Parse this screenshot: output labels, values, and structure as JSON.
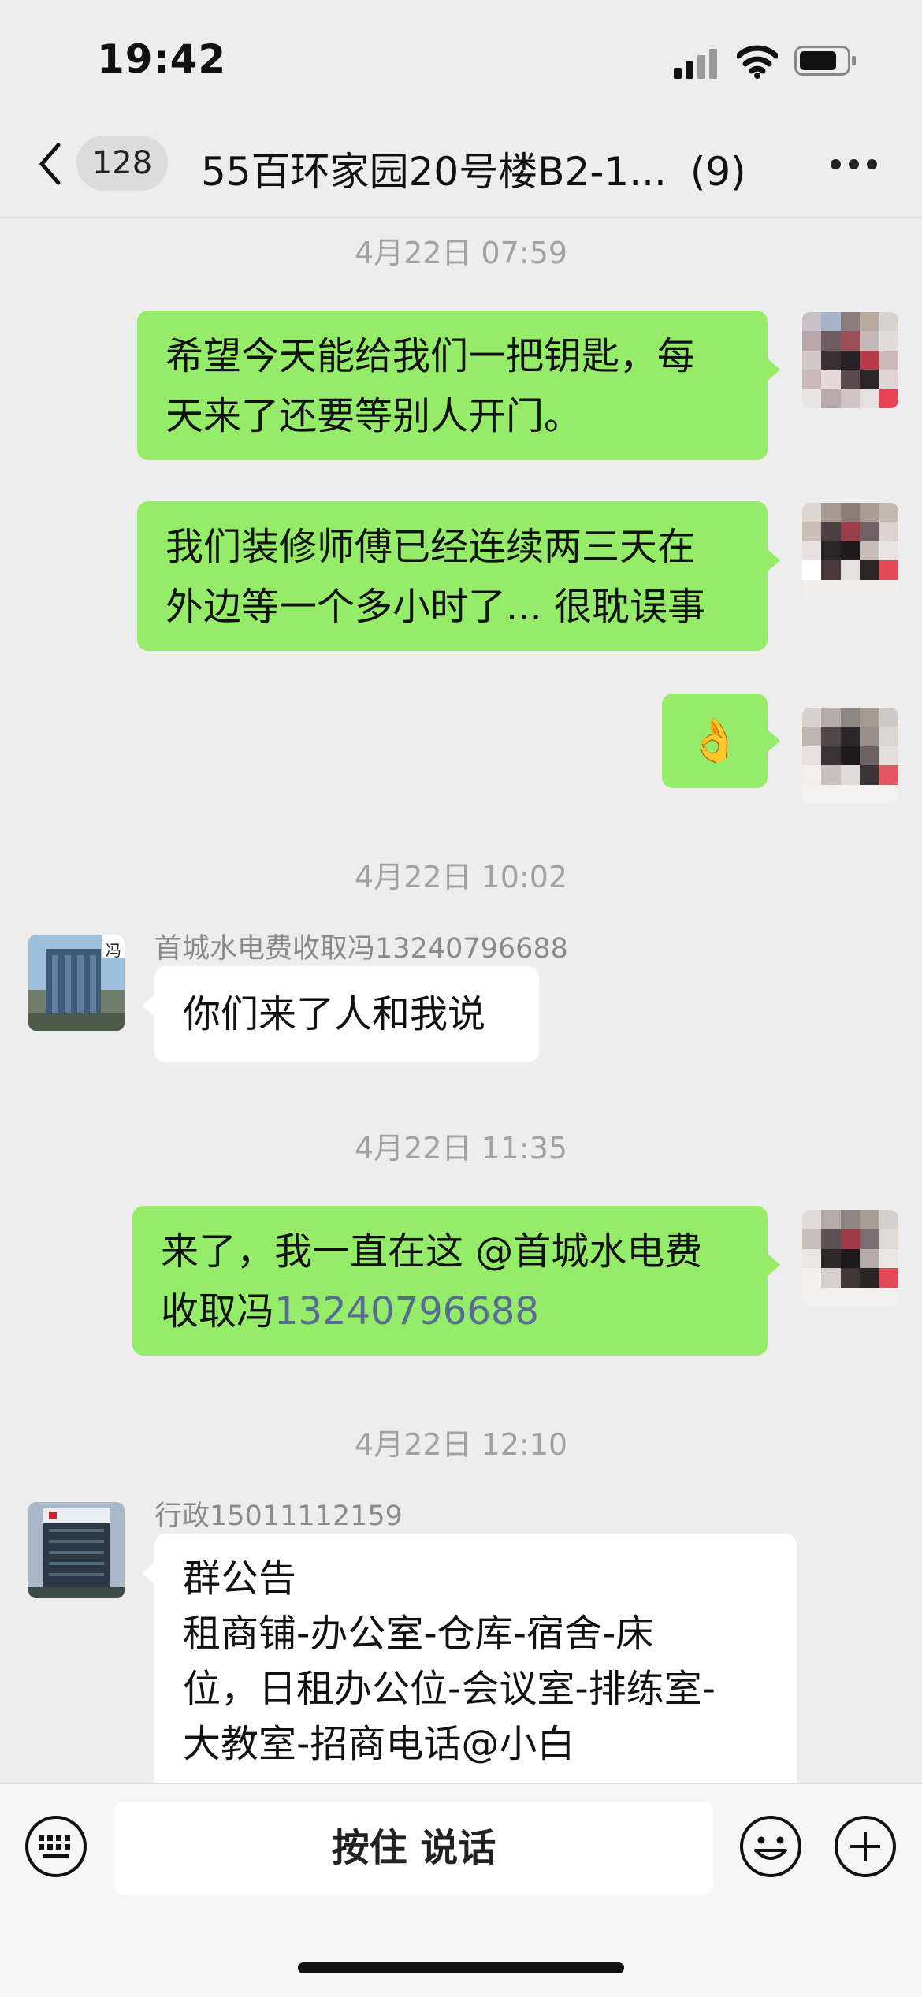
{
  "status_bar": {
    "time": "19:42"
  },
  "nav": {
    "unread_count": "128",
    "title": "55百环家园20号楼B2-1...",
    "member_count": "(9)"
  },
  "messages": [
    {
      "timestamp": "4月22日 07:59"
    },
    {
      "side": "me",
      "lines": [
        "希望今天能给我们一把钥匙，每",
        "天来了还要等别人开门。"
      ]
    },
    {
      "side": "me",
      "lines": [
        "我们装修师傅已经连续两三天在",
        "外边等一个多小时了... 很耽误事"
      ]
    },
    {
      "side": "me",
      "emoji": "👌"
    },
    {
      "timestamp": "4月22日 10:02"
    },
    {
      "side": "other",
      "sender": "首城水电费收取冯13240796688",
      "avatar_label": "冯",
      "lines": [
        "你们来了人和我说"
      ]
    },
    {
      "timestamp": "4月22日 11:35"
    },
    {
      "side": "me",
      "line1": "来了，我一直在这 @首城水电费",
      "line2_prefix": "收取冯",
      "line2_link": "13240796688"
    },
    {
      "timestamp": "4月22日 12:10"
    },
    {
      "side": "other",
      "sender": "行政15011112159",
      "lines": [
        "群公告",
        "租商铺-办公室-仓库-宿舍-床",
        "位，日租办公位-会议室-排练室-",
        "大教室-招商电话@小白"
      ]
    }
  ],
  "input_bar": {
    "hold_to_talk": "按住 说话"
  },
  "icons": {
    "back": "back-chevron-icon",
    "more": "more-icon",
    "keyboard": "keyboard-icon",
    "emoji": "emoji-icon",
    "plus": "plus-icon"
  },
  "colors": {
    "my_bubble": "#95ec69",
    "other_bubble": "#ffffff",
    "background": "#ededed",
    "link": "#576b95"
  }
}
